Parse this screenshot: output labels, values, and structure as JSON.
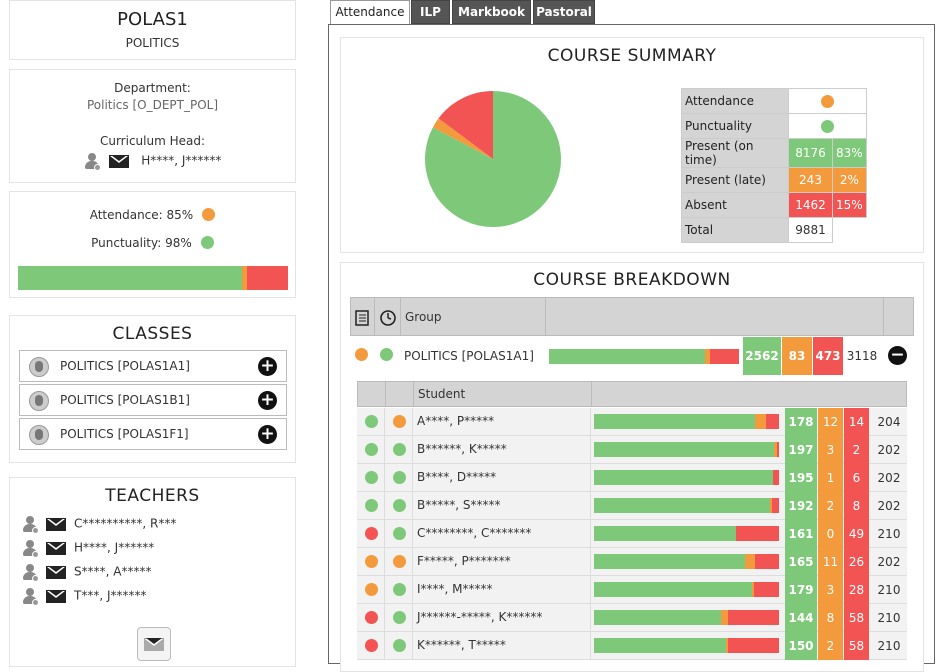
{
  "colors": {
    "green": "#7ec87a",
    "orange": "#f39a3d",
    "red": "#f25454"
  },
  "course": {
    "code": "POLAS1",
    "name": "POLITICS"
  },
  "info": {
    "department_label": "Department:",
    "department_value": "Politics [O_DEPT_POL]",
    "head_label": "Curriculum Head:",
    "head_name": "H****, J******"
  },
  "stats": {
    "attendance_text": "Attendance: 85%",
    "attendance_color": "orange",
    "punctuality_text": "Punctuality: 98%",
    "punctuality_color": "green",
    "bar": {
      "green": 83,
      "orange": 2,
      "red": 15
    }
  },
  "classes": {
    "title": "CLASSES",
    "items": [
      {
        "label": "POLITICS [POLAS1A1]"
      },
      {
        "label": "POLITICS [POLAS1B1]"
      },
      {
        "label": "POLITICS [POLAS1F1]"
      }
    ]
  },
  "teachers": {
    "title": "TEACHERS",
    "items": [
      {
        "name": "C**********, R***"
      },
      {
        "name": "H****, J******"
      },
      {
        "name": "S****, A*****"
      },
      {
        "name": "T***, J******"
      }
    ]
  },
  "tabs": [
    {
      "label": "Attendance",
      "active": true
    },
    {
      "label": "ILP",
      "active": false
    },
    {
      "label": "Markbook",
      "active": false
    },
    {
      "label": "Pastoral",
      "active": false
    }
  ],
  "summary": {
    "title": "COURSE SUMMARY",
    "rows": [
      {
        "label": "Attendance",
        "dot": "orange"
      },
      {
        "label": "Punctuality",
        "dot": "green"
      },
      {
        "label": "Present (on time)",
        "count": "8176",
        "pct": "83%",
        "color": "green"
      },
      {
        "label": "Present (late)",
        "count": "243",
        "pct": "2%",
        "color": "orange"
      },
      {
        "label": "Absent",
        "count": "1462",
        "pct": "15%",
        "color": "red"
      },
      {
        "label": "Total",
        "count": "9881"
      }
    ],
    "pie": [
      {
        "label": "Present (on time)",
        "value": 8176,
        "color": "green"
      },
      {
        "label": "Present (late)",
        "value": 243,
        "color": "orange"
      },
      {
        "label": "Absent",
        "value": 1462,
        "color": "red"
      }
    ]
  },
  "breakdown": {
    "title": "COURSE BREAKDOWN",
    "group_header": "Group",
    "group": {
      "att_dot": "orange",
      "punc_dot": "green",
      "label": "POLITICS [POLAS1A1]",
      "present": 2562,
      "late": 83,
      "absent": 473,
      "total": 3118
    },
    "student_header": "Student",
    "students": [
      {
        "name": "A****, P*****",
        "att": "green",
        "punc": "orange",
        "present": 178,
        "late": 12,
        "absent": 14,
        "total": 204
      },
      {
        "name": "B******, K*****",
        "att": "green",
        "punc": "green",
        "present": 197,
        "late": 3,
        "absent": 2,
        "total": 202
      },
      {
        "name": "B****, D*****",
        "att": "green",
        "punc": "green",
        "present": 195,
        "late": 1,
        "absent": 6,
        "total": 202
      },
      {
        "name": "B*****, S*****",
        "att": "green",
        "punc": "green",
        "present": 192,
        "late": 2,
        "absent": 8,
        "total": 202
      },
      {
        "name": "C********, C*******",
        "att": "red",
        "punc": "green",
        "present": 161,
        "late": 0,
        "absent": 49,
        "total": 210
      },
      {
        "name": "F*****, P*******",
        "att": "orange",
        "punc": "orange",
        "present": 165,
        "late": 11,
        "absent": 26,
        "total": 202
      },
      {
        "name": "I****, M*****",
        "att": "orange",
        "punc": "green",
        "present": 179,
        "late": 3,
        "absent": 28,
        "total": 210
      },
      {
        "name": "J******-*****, K******",
        "att": "red",
        "punc": "green",
        "present": 144,
        "late": 8,
        "absent": 58,
        "total": 210
      },
      {
        "name": "K******, T*****",
        "att": "red",
        "punc": "green",
        "present": 150,
        "late": 2,
        "absent": 58,
        "total": 210
      }
    ]
  }
}
